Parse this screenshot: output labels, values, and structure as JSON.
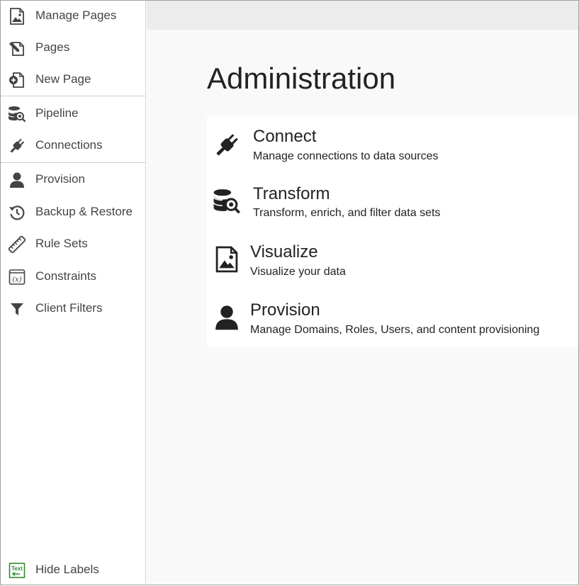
{
  "sidebar": {
    "items": [
      {
        "label": "Manage Pages",
        "icon": "image-page-icon"
      },
      {
        "label": "Pages",
        "icon": "edit-page-icon"
      },
      {
        "label": "New Page",
        "icon": "new-page-icon"
      },
      {
        "label": "Pipeline",
        "icon": "database-search-icon"
      },
      {
        "label": "Connections",
        "icon": "plug-icon"
      },
      {
        "label": "Provision",
        "icon": "user-icon"
      },
      {
        "label": "Backup & Restore",
        "icon": "history-icon"
      },
      {
        "label": "Rule Sets",
        "icon": "ruler-icon"
      },
      {
        "label": "Constraints",
        "icon": "variable-icon"
      },
      {
        "label": "Client Filters",
        "icon": "filter-icon"
      }
    ],
    "hide_labels": {
      "label": "Hide Labels",
      "icon": "text-toggle-icon"
    }
  },
  "main": {
    "title": "Administration",
    "cards": [
      {
        "title": "Connect",
        "description": "Manage connections to data sources",
        "icon": "plug-icon"
      },
      {
        "title": "Transform",
        "description": "Transform, enrich, and filter data sets",
        "icon": "database-search-icon"
      },
      {
        "title": "Visualize",
        "description": "Visualize your data",
        "icon": "image-page-icon"
      },
      {
        "title": "Provision",
        "description": "Manage Domains, Roles, Users, and content provisioning",
        "icon": "user-icon"
      }
    ]
  },
  "colors": {
    "sidebar_bg": "#ffffff",
    "main_bg": "#f9f9f9",
    "topbar_bg": "#ececec",
    "icon_dark": "#333333",
    "hide_labels_green": "#2e8b2e"
  }
}
